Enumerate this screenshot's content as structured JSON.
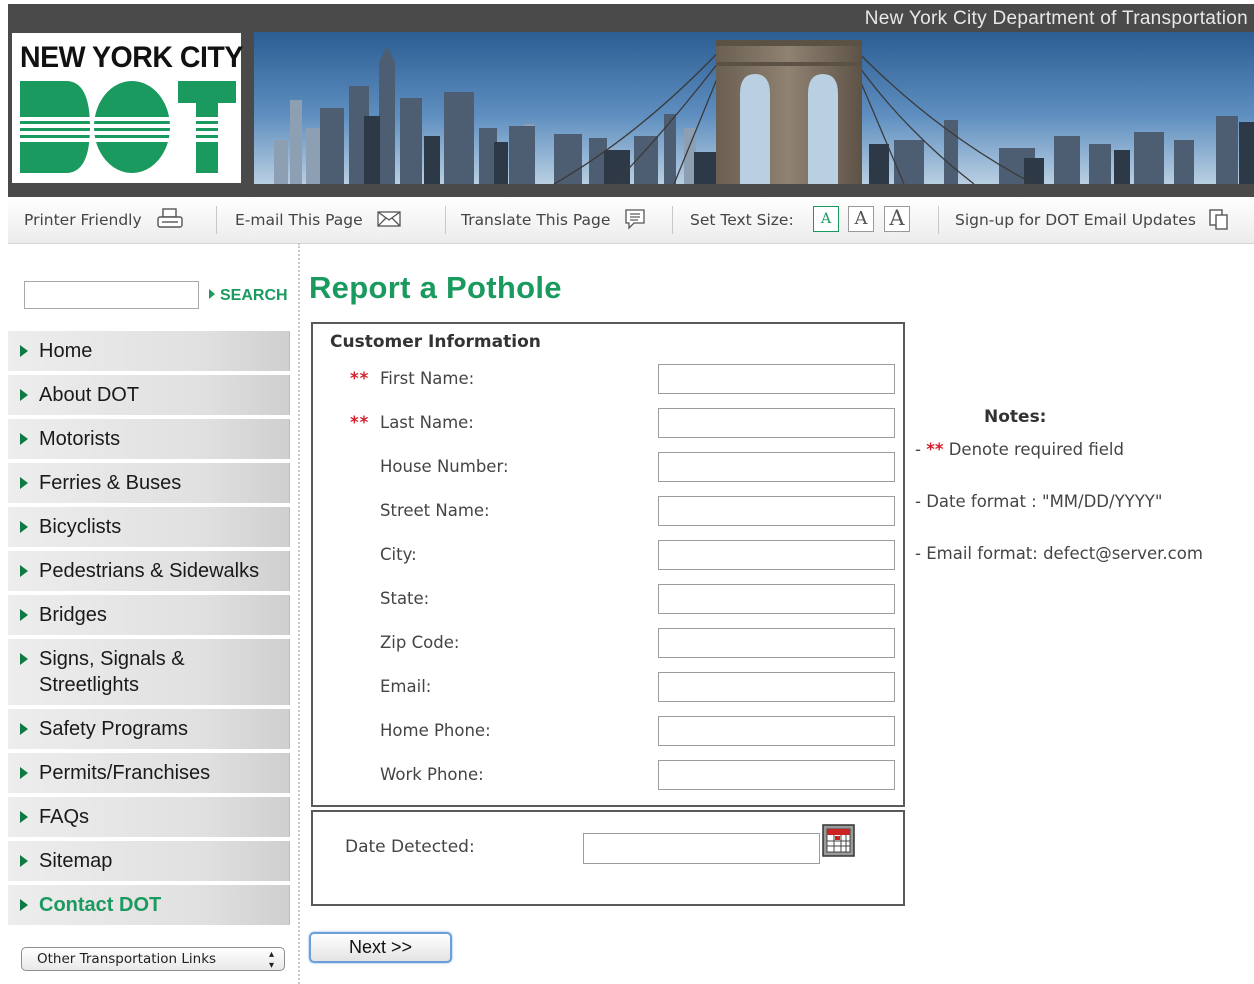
{
  "header": {
    "agency_name": "New York City Department of Transportation",
    "logo_line1": "NEW YORK CITY",
    "logo_line2": "DOT",
    "brand_color": "#1a9a5e"
  },
  "utility_bar": {
    "printer_friendly": "Printer Friendly",
    "email_page": "E-mail This Page",
    "translate_page": "Translate This Page",
    "text_size_label": "Set Text Size:",
    "text_sizes": [
      "A",
      "A",
      "A"
    ],
    "signup": "Sign-up for DOT Email Updates"
  },
  "search": {
    "button_label": "SEARCH",
    "value": ""
  },
  "sidebar": {
    "items": [
      {
        "label": "Home"
      },
      {
        "label": "About DOT"
      },
      {
        "label": "Motorists"
      },
      {
        "label": "Ferries & Buses"
      },
      {
        "label": "Bicyclists"
      },
      {
        "label": "Pedestrians & Sidewalks"
      },
      {
        "label": "Bridges"
      },
      {
        "label": "Signs, Signals & Streetlights"
      },
      {
        "label": "Safety Programs"
      },
      {
        "label": "Permits/Franchises"
      },
      {
        "label": "FAQs"
      },
      {
        "label": "Sitemap"
      },
      {
        "label": "Contact DOT",
        "active": true
      }
    ],
    "other_links_select": "Other Transportation Links"
  },
  "main": {
    "title": "Report a Pothole",
    "customer_section": {
      "heading": "Customer Information",
      "required_marker": "**",
      "fields": [
        {
          "label": "First Name:",
          "required": true,
          "value": ""
        },
        {
          "label": "Last Name:",
          "required": true,
          "value": ""
        },
        {
          "label": "House Number:",
          "required": false,
          "value": ""
        },
        {
          "label": "Street Name:",
          "required": false,
          "value": ""
        },
        {
          "label": "City:",
          "required": false,
          "value": ""
        },
        {
          "label": "State:",
          "required": false,
          "value": ""
        },
        {
          "label": "Zip Code:",
          "required": false,
          "value": ""
        },
        {
          "label": "Email:",
          "required": false,
          "value": ""
        },
        {
          "label": "Home Phone:",
          "required": false,
          "value": ""
        },
        {
          "label": "Work Phone:",
          "required": false,
          "value": ""
        }
      ]
    },
    "date_section": {
      "label": "Date Detected:",
      "value": "",
      "calendar_icon": "calendar-icon"
    },
    "next_button": "Next >>"
  },
  "notes": {
    "title": "Notes:",
    "items": [
      {
        "prefix": "- ",
        "star": "**",
        "text": " Denote required field"
      },
      {
        "prefix": "- ",
        "star": "",
        "text": "Date format : \"MM/DD/YYYY\""
      },
      {
        "prefix": "- ",
        "star": "",
        "text": "Email format: defect@server.com"
      }
    ]
  }
}
